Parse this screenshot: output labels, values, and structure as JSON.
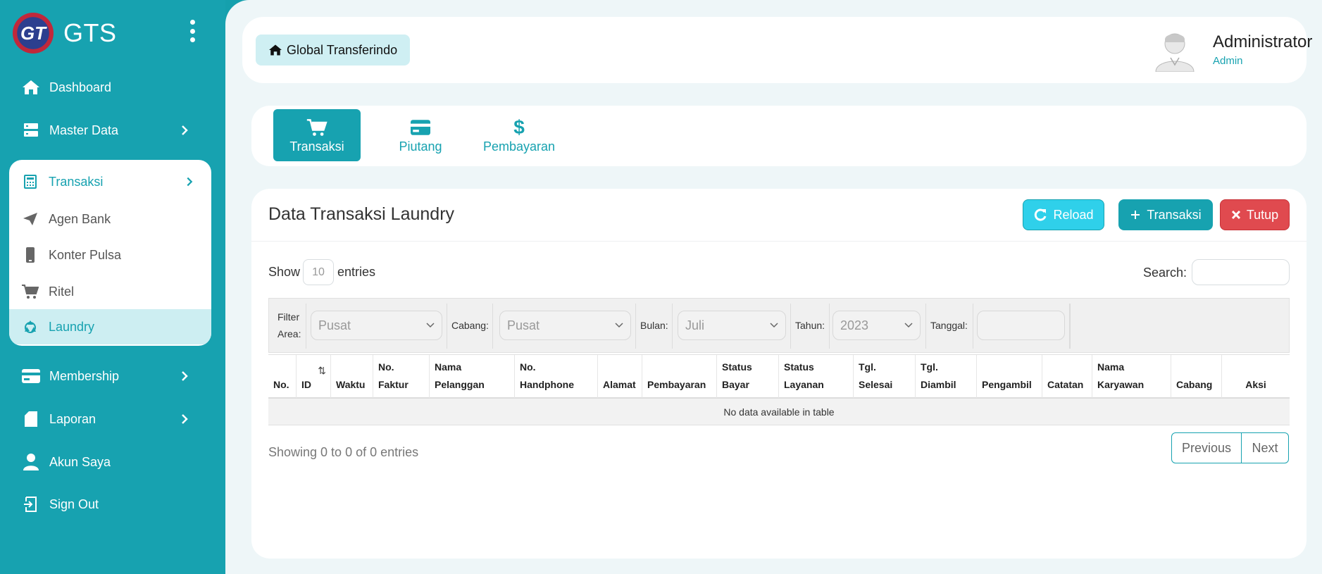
{
  "app": {
    "name": "GTS",
    "logo_text": "GT"
  },
  "sidebar": {
    "items": [
      {
        "label": "Dashboard",
        "icon": "home-icon"
      },
      {
        "label": "Master Data",
        "icon": "server-icon",
        "has_children": true
      },
      {
        "label": "Membership",
        "icon": "card-icon",
        "has_children": true
      },
      {
        "label": "Laporan",
        "icon": "file-icon",
        "has_children": true
      },
      {
        "label": "Akun Saya",
        "icon": "user-icon"
      },
      {
        "label": "Sign Out",
        "icon": "sign-out-icon"
      }
    ],
    "transaksi_group": {
      "label": "Transaksi",
      "icon": "calculator-icon",
      "children": [
        {
          "label": "Agen Bank",
          "icon": "paper-plane-icon"
        },
        {
          "label": "Konter Pulsa",
          "icon": "mobile-icon"
        },
        {
          "label": "Ritel",
          "icon": "cart-icon"
        },
        {
          "label": "Laundry",
          "icon": "recycle-icon",
          "active": true
        }
      ]
    }
  },
  "header": {
    "breadcrumb": "Global Transferindo",
    "user_name": "Administrator",
    "user_role": "Admin"
  },
  "tabs": [
    {
      "label": "Transaksi",
      "icon": "cart-icon",
      "active": true
    },
    {
      "label": "Piutang",
      "icon": "credit-card-icon"
    },
    {
      "label": "Pembayaran",
      "icon": "dollar-icon"
    }
  ],
  "card": {
    "title": "Data Transaksi Laundry",
    "buttons": {
      "reload": "Reload",
      "add": "Transaksi",
      "close": "Tutup"
    }
  },
  "table_controls": {
    "show_label": "Show",
    "entries_value": "10",
    "entries_label": "entries",
    "search_label": "Search:"
  },
  "filters": {
    "area_label": "Filter Area:",
    "area_value": "Pusat",
    "cabang_label": "Cabang:",
    "cabang_value": "Pusat",
    "bulan_label": "Bulan:",
    "bulan_value": "Juli",
    "tahun_label": "Tahun:",
    "tahun_value": "2023",
    "tanggal_label": "Tanggal:",
    "tanggal_value": ""
  },
  "table": {
    "columns": [
      "No.",
      "ID",
      "Waktu",
      "No. Faktur",
      "Nama Pelanggan",
      "No. Handphone",
      "Alamat",
      "Pembayaran",
      "Status Bayar",
      "Status Layanan",
      "Tgl. Selesai",
      "Tgl. Diambil",
      "Pengambil",
      "Catatan",
      "Nama Karyawan",
      "Cabang",
      "Aksi"
    ],
    "empty_text": "No data available in table"
  },
  "footer": {
    "info": "Showing 0 to 0 of 0 entries",
    "prev": "Previous",
    "next": "Next"
  },
  "colors": {
    "primary": "#17a2b0",
    "danger": "#e04a4f",
    "info": "#2fd0ea"
  }
}
